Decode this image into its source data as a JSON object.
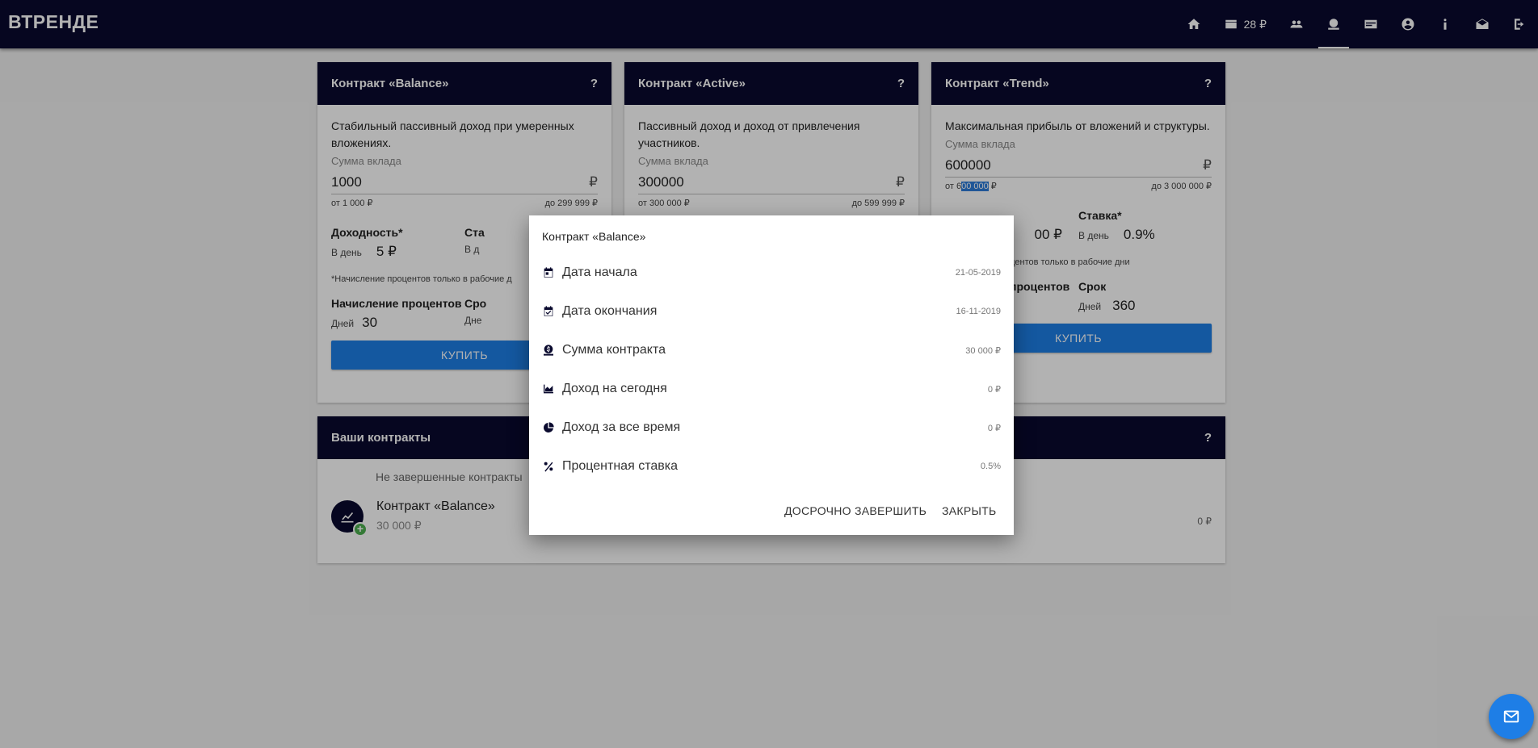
{
  "brand": "ВТРЕНДЕ",
  "nav": {
    "balance": "28 ₽",
    "icons": [
      "home-icon",
      "wallet-icon",
      "team-icon",
      "contracts-icon",
      "cash-icon",
      "profile-icon",
      "info-icon",
      "mail-icon",
      "logout-icon"
    ],
    "active": "contracts-icon"
  },
  "cards": [
    {
      "title": "Контракт «Balance»",
      "help": "?",
      "desc": "Стабильный пассивный доход при умеренных вложениях.",
      "sum_label": "Сумма вклада",
      "amount": "1000",
      "currency": "₽",
      "min": "от 1 000 ₽",
      "max": "до 299 999 ₽",
      "profit_title": "Доходность*",
      "profit_unit": "В день",
      "profit_value": "5 ₽",
      "rate_title": "Ста",
      "rate_unit": "В д",
      "note": "*Начисление процентов только в рабочие д",
      "accrual_title": "Начисление процентов",
      "accrual_unit": "Дней",
      "accrual_value": "30",
      "term_title": "Сро",
      "term_unit": "Дне",
      "buy": "КУПИТЬ"
    },
    {
      "title": "Контракт «Active»",
      "help": "?",
      "desc": "Пассивный доход и доход от привлечения участников.",
      "sum_label": "Сумма вклада",
      "amount": "300000",
      "currency": "₽",
      "min": "от 300 000 ₽",
      "max": "до 599 999 ₽"
    },
    {
      "title": "Контракт «Trend»",
      "help": "?",
      "desc": "Максимальная прибыль от вложений и структуры.",
      "sum_label": "Сумма вклада",
      "amount": "600000",
      "currency": "₽",
      "min_prefix": "от 6",
      "min_highlight": "00 000",
      "min_suffix": " ₽",
      "max": "до 3 000 000 ₽",
      "profit_value": "00 ₽",
      "rate_title": "Ставка*",
      "rate_unit": "В день",
      "rate_value": "0.9%",
      "note": "роцентов только в рабочие дни",
      "accrual_title": "процентов",
      "term_title": "Срок",
      "term_unit": "Дней",
      "term_value": "360",
      "buy": "КУПИТЬ"
    }
  ],
  "your_contracts": {
    "title": "Ваши контракты",
    "help": "?",
    "subtitle": "Не завершенные контракты",
    "item": {
      "name": "Контракт «Balance»",
      "sum": "30 000 ₽",
      "right": "0 ₽"
    }
  },
  "modal": {
    "title": "Контракт «Balance»",
    "rows": [
      {
        "icon": "calendar-icon",
        "label": "Дата начала",
        "value": "21-05-2019"
      },
      {
        "icon": "calendar-check-icon",
        "label": "Дата окончания",
        "value": "16-11-2019"
      },
      {
        "icon": "money-icon",
        "label": "Сумма контракта",
        "value": "30 000 ₽"
      },
      {
        "icon": "area-chart-icon",
        "label": "Доход на сегодня",
        "value": "0 ₽"
      },
      {
        "icon": "pie-chart-icon",
        "label": "Доход за все время",
        "value": "0 ₽"
      },
      {
        "icon": "percent-icon",
        "label": "Процентная ставка",
        "value": "0.5%"
      }
    ],
    "finish_early": "ДОСРОЧНО ЗАВЕРШИТЬ",
    "close": "ЗАКРЫТЬ"
  },
  "colors": {
    "navy": "#0a0a2e",
    "accent": "#1e7ee6",
    "green": "#4caf50"
  }
}
